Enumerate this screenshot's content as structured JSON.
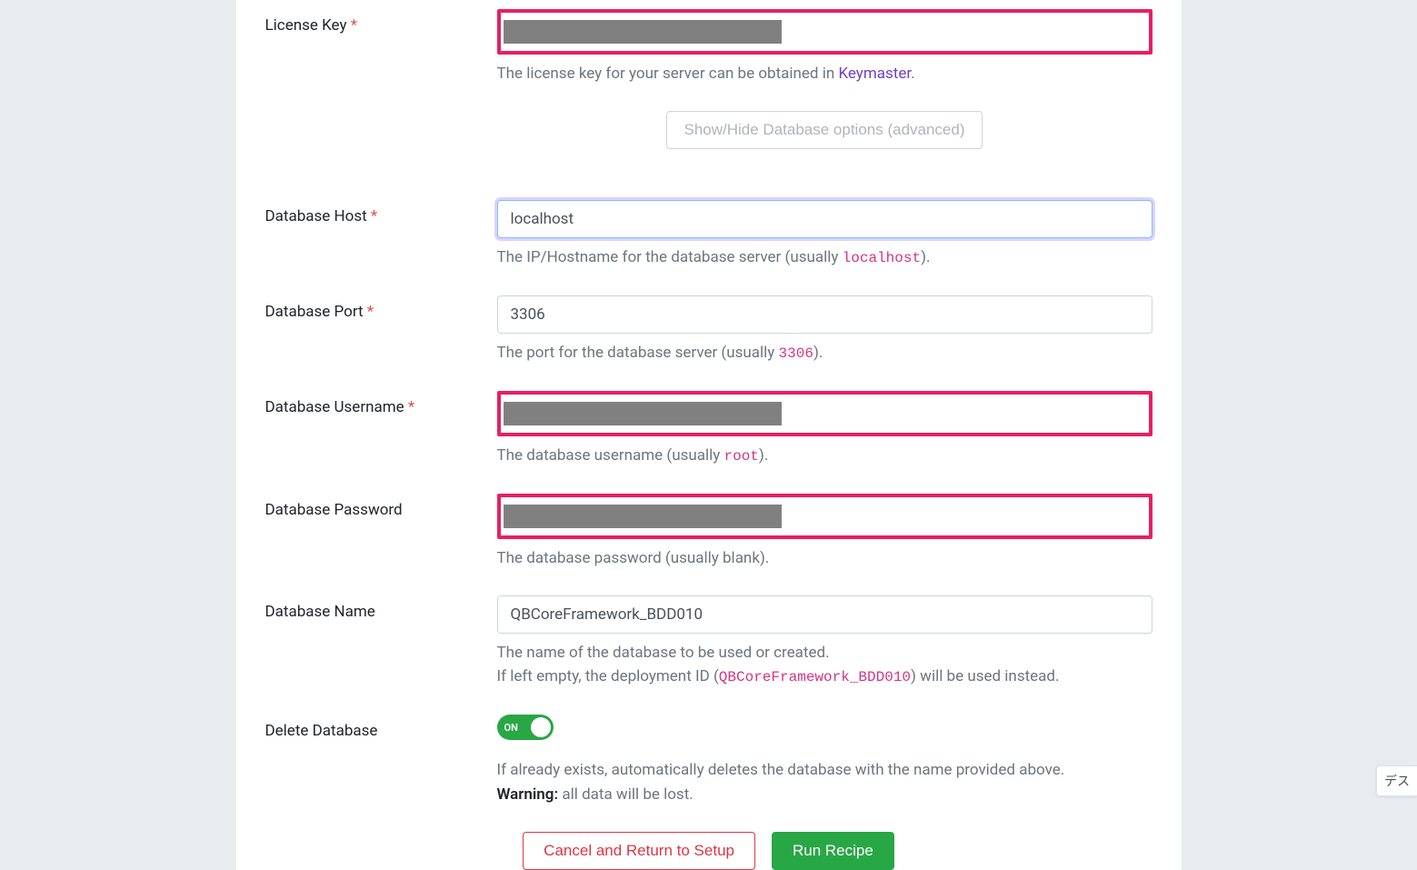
{
  "form": {
    "license_key": {
      "label": "License Key",
      "required": true,
      "help_prefix": "The license key for your server can be obtained in ",
      "help_link": "Keymaster",
      "help_suffix": "."
    },
    "toggle_advanced": "Show/Hide Database options (advanced)",
    "db_host": {
      "label": "Database Host",
      "required": true,
      "value": "localhost",
      "help_prefix": "The IP/Hostname for the database server (usually ",
      "help_code": "localhost",
      "help_suffix": ")."
    },
    "db_port": {
      "label": "Database Port",
      "required": true,
      "value": "3306",
      "help_prefix": "The port for the database server (usually ",
      "help_code": "3306",
      "help_suffix": ")."
    },
    "db_username": {
      "label": "Database Username",
      "required": true,
      "help_prefix": "The database username (usually ",
      "help_code": "root",
      "help_suffix": ")."
    },
    "db_password": {
      "label": "Database Password",
      "required": false,
      "help": "The database password (usually blank)."
    },
    "db_name": {
      "label": "Database Name",
      "required": false,
      "value": "QBCoreFramework_BDD010",
      "help_line1": "The name of the database to be used or created.",
      "help_line2_prefix": "If left empty, the deployment ID (",
      "help_line2_code": "QBCoreFramework_BDD010",
      "help_line2_suffix": ") will be used instead."
    },
    "delete_db": {
      "label": "Delete Database",
      "state": "ON",
      "help_line1": "If already exists, automatically deletes the database with the name provided above.",
      "warning_label": "Warning:",
      "warning_text": " all data will be lost."
    }
  },
  "actions": {
    "cancel": "Cancel and Return to Setup",
    "run": "Run Recipe"
  },
  "corner": "デス"
}
